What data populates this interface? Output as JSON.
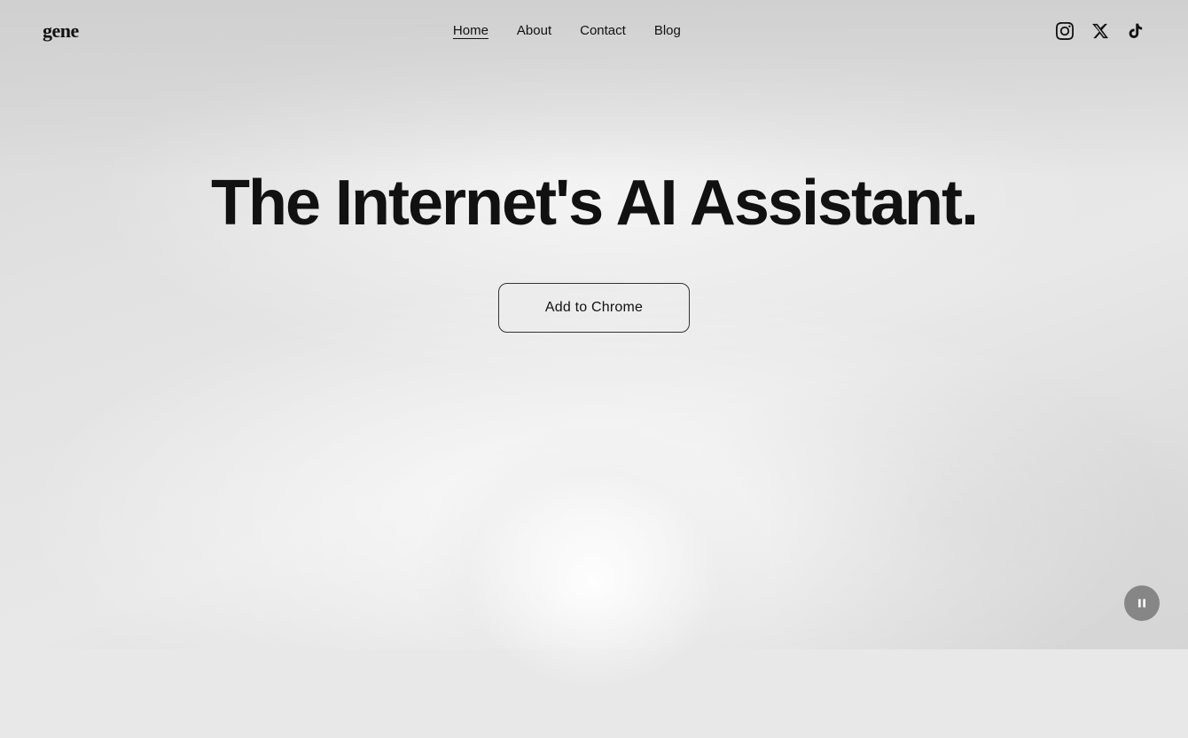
{
  "logo": {
    "text": "gene"
  },
  "nav": {
    "links": [
      {
        "label": "Home",
        "active": true
      },
      {
        "label": "About",
        "active": false
      },
      {
        "label": "Contact",
        "active": false
      },
      {
        "label": "Blog",
        "active": false
      }
    ],
    "icons": [
      {
        "name": "instagram-icon",
        "symbol": "instagram"
      },
      {
        "name": "x-twitter-icon",
        "symbol": "x"
      },
      {
        "name": "tiktok-icon",
        "symbol": "tiktok"
      }
    ]
  },
  "hero": {
    "title": "The Internet's AI Assistant.",
    "cta_label": "Add to Chrome"
  },
  "pause_button": {
    "label": "Pause"
  }
}
